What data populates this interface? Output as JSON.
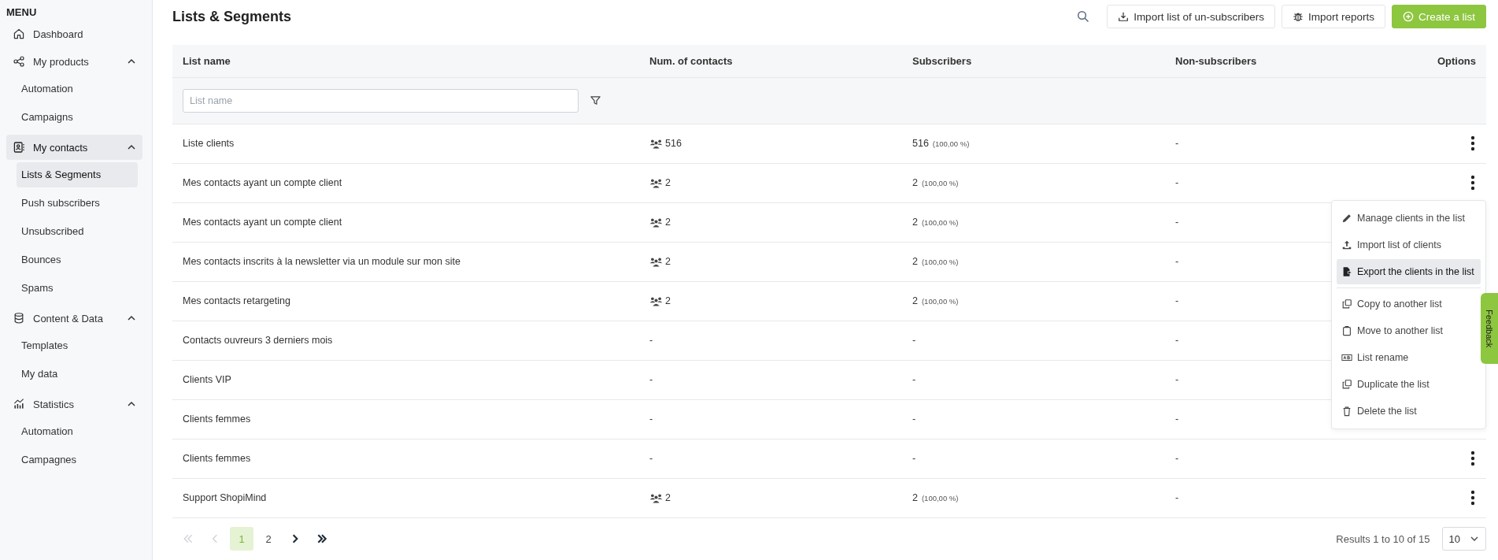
{
  "sidebar": {
    "title": "MENU",
    "items": [
      {
        "kind": "link",
        "label": "Dashboard",
        "selected": false
      },
      {
        "kind": "group",
        "label": "My products",
        "expanded": true,
        "selected": false,
        "children": [
          {
            "label": "Automation",
            "selected": false
          },
          {
            "label": "Campaigns",
            "selected": false
          }
        ]
      },
      {
        "kind": "group",
        "label": "My contacts",
        "expanded": true,
        "selected": true,
        "children": [
          {
            "label": "Lists & Segments",
            "selected": true
          },
          {
            "label": "Push subscribers",
            "selected": false
          },
          {
            "label": "Unsubscribed",
            "selected": false
          },
          {
            "label": "Bounces",
            "selected": false
          },
          {
            "label": "Spams",
            "selected": false
          }
        ]
      },
      {
        "kind": "group",
        "label": "Content & Data",
        "expanded": true,
        "selected": false,
        "children": [
          {
            "label": "Templates",
            "selected": false
          },
          {
            "label": "My data",
            "selected": false
          }
        ]
      },
      {
        "kind": "group",
        "label": "Statistics",
        "expanded": true,
        "selected": false,
        "children": [
          {
            "label": "Automation",
            "selected": false
          },
          {
            "label": "Campagnes",
            "selected": false
          }
        ]
      }
    ]
  },
  "page": {
    "title": "Lists & Segments",
    "actions": [
      {
        "kind": "outline",
        "label": "Import list of un-subscribers"
      },
      {
        "kind": "outline",
        "label": "Import reports"
      },
      {
        "kind": "primary",
        "label": "Create a list"
      }
    ]
  },
  "table": {
    "columns": [
      "List name",
      "Num. of contacts",
      "Subscribers",
      "Non-subscribers",
      "Options"
    ],
    "filter": {
      "placeholder": "List name"
    },
    "rows": [
      {
        "kind": "counted",
        "name": "Liste clients",
        "contacts": "516",
        "subscribers": "516",
        "subscribers_share": "(100,00 %)",
        "non_subscribers": "-",
        "menu_open": false
      },
      {
        "kind": "counted",
        "name": "Mes contacts ayant un compte client",
        "contacts": "2",
        "subscribers": "2",
        "subscribers_share": "(100,00 %)",
        "non_subscribers": "-",
        "menu_open": true
      },
      {
        "kind": "counted",
        "name": "Mes contacts ayant un compte client",
        "contacts": "2",
        "subscribers": "2",
        "subscribers_share": "(100,00 %)",
        "non_subscribers": "-",
        "menu_open": false
      },
      {
        "kind": "counted",
        "name": "Mes contacts inscrits à la newsletter via un module sur mon site",
        "contacts": "2",
        "subscribers": "2",
        "subscribers_share": "(100,00 %)",
        "non_subscribers": "-",
        "menu_open": false
      },
      {
        "kind": "counted",
        "name": "Mes contacts retargeting",
        "contacts": "2",
        "subscribers": "2",
        "subscribers_share": "(100,00 %)",
        "non_subscribers": "-",
        "menu_open": false
      },
      {
        "kind": "empty",
        "name": "Contacts ouvreurs 3 derniers mois",
        "contacts": "-",
        "subscribers": "-",
        "non_subscribers": "-",
        "menu_open": false
      },
      {
        "kind": "empty",
        "name": "Clients VIP",
        "contacts": "-",
        "subscribers": "-",
        "non_subscribers": "-",
        "menu_open": false
      },
      {
        "kind": "empty",
        "name": "Clients femmes",
        "contacts": "-",
        "subscribers": "-",
        "non_subscribers": "-",
        "menu_open": false
      },
      {
        "kind": "empty",
        "name": "Clients femmes",
        "contacts": "-",
        "subscribers": "-",
        "non_subscribers": "-",
        "menu_open": false
      },
      {
        "kind": "counted",
        "name": "Support ShopiMind",
        "contacts": "2",
        "subscribers": "2",
        "subscribers_share": "(100,00 %)",
        "non_subscribers": "-",
        "menu_open": false
      }
    ]
  },
  "row_menu": {
    "items": [
      {
        "kind": "item",
        "label": "Manage clients in the list",
        "selected": false
      },
      {
        "kind": "item",
        "label": "Import list of clients",
        "selected": false
      },
      {
        "kind": "item",
        "label": "Export the clients in the list",
        "selected": true
      },
      {
        "kind": "divider"
      },
      {
        "kind": "item",
        "label": "Copy to another list",
        "selected": false
      },
      {
        "kind": "item",
        "label": "Move to another list",
        "selected": false
      },
      {
        "kind": "item",
        "label": "List rename",
        "selected": false
      },
      {
        "kind": "item",
        "label": "Duplicate the list",
        "selected": false
      },
      {
        "kind": "item",
        "label": "Delete the list",
        "selected": false
      }
    ]
  },
  "pagination": {
    "controls": [
      {
        "kind": "first",
        "disabled": true
      },
      {
        "kind": "prev",
        "disabled": true
      },
      {
        "kind": "page",
        "label": "1",
        "selected": true
      },
      {
        "kind": "page",
        "label": "2",
        "selected": false
      },
      {
        "kind": "next",
        "disabled": false
      },
      {
        "kind": "last",
        "disabled": false
      }
    ],
    "results": "Results 1 to 10 of 15",
    "page_size": "10"
  },
  "feedback": {
    "label": "Feedback"
  }
}
